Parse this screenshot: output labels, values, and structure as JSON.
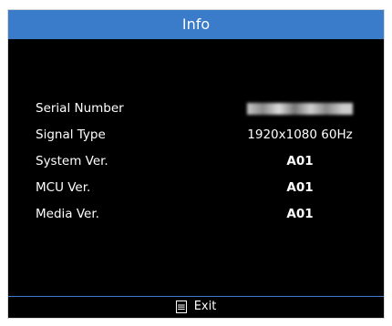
{
  "window": {
    "title": "Info"
  },
  "rows": [
    {
      "label": "Serial Number",
      "value": "",
      "blurred": true
    },
    {
      "label": "Signal Type",
      "value": "1920x1080 60Hz"
    },
    {
      "label": "System Ver.",
      "value": "A01"
    },
    {
      "label": "MCU Ver.",
      "value": "A01"
    },
    {
      "label": "Media Ver.",
      "value": "A01"
    }
  ],
  "footer": {
    "exit_label": "Exit",
    "exit_icon": "menu-icon"
  },
  "colors": {
    "title_bar": "#3a7cc9",
    "background": "#000000",
    "text": "#ffffff",
    "divider": "#3a7cc9"
  }
}
